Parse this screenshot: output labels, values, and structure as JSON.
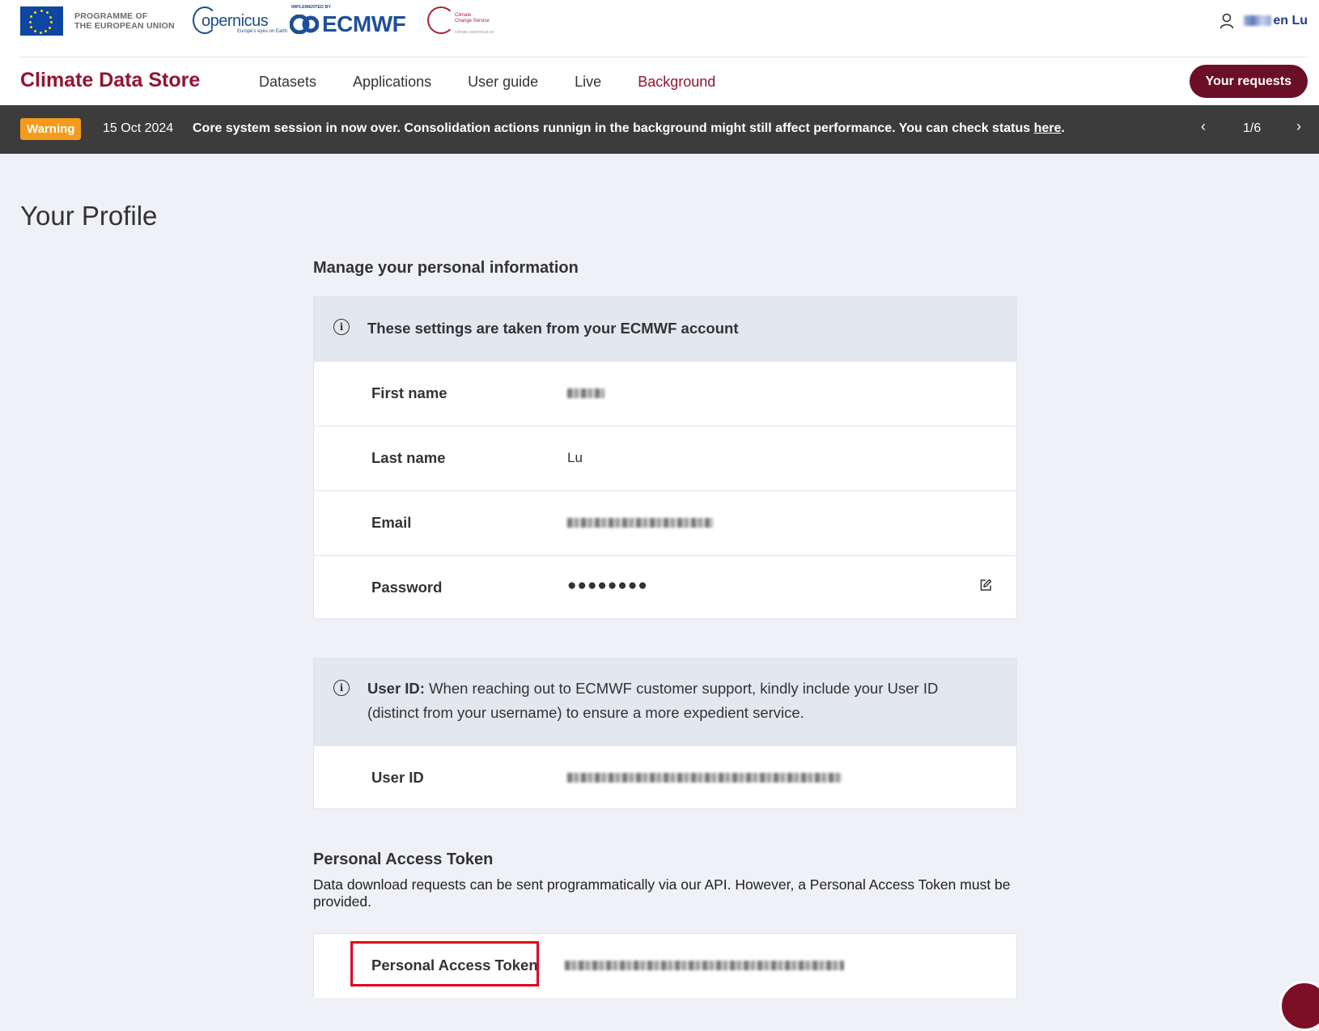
{
  "header": {
    "eu_text_line1": "PROGRAMME OF",
    "eu_text_line2": "THE EUROPEAN UNION",
    "copernicus_word": "opernicus",
    "copernicus_tag": "Europe's eyes on Earth",
    "ecmwf_small": "IMPLEMENTED BY",
    "ecmwf_big": "ECMWF",
    "c3s_line1": "Climate",
    "c3s_line2": "Change Service",
    "c3s_url": "climate.copernicus.eu",
    "user_name": "en Lu"
  },
  "nav": {
    "brand": "Climate Data Store",
    "links": [
      "Datasets",
      "Applications",
      "User guide",
      "Live",
      "Background"
    ],
    "active": "Background",
    "requests_button": "Your requests"
  },
  "banner": {
    "badge": "Warning",
    "date": "15 Oct 2024",
    "message": "Core system session in now over. Consolidation actions runnign in the background might still affect performance. You can check status ",
    "link_text": "here",
    "message_end": ".",
    "page": "1/6",
    "prev": "‹",
    "next": "›"
  },
  "profile": {
    "title": "Your Profile",
    "manage_heading": "Manage your personal information",
    "settings_note": "These settings are taken from your ECMWF account",
    "fields": [
      {
        "label": "First name",
        "value": ""
      },
      {
        "label": "Last name",
        "value": "Lu"
      },
      {
        "label": "Email",
        "value": ""
      },
      {
        "label": "Password",
        "value": "●●●●●●●●"
      }
    ],
    "user_id_note_bold": "User ID:",
    "user_id_note": " When reaching out to ECMWF customer support, kindly include your User ID (distinct from your username) to ensure a more expedient service.",
    "user_id_label": "User ID",
    "pat_heading": "Personal Access Token",
    "pat_description": "Data download requests can be sent programmatically via our API. However, a Personal Access Token must be provided.",
    "pat_label": "Personal Access Token"
  },
  "colors": {
    "brand": "#941333",
    "button": "#6b0f27",
    "warning": "#f59a1b",
    "banner_bg": "#3c3c3c",
    "highlight_box": "#e0001b"
  }
}
